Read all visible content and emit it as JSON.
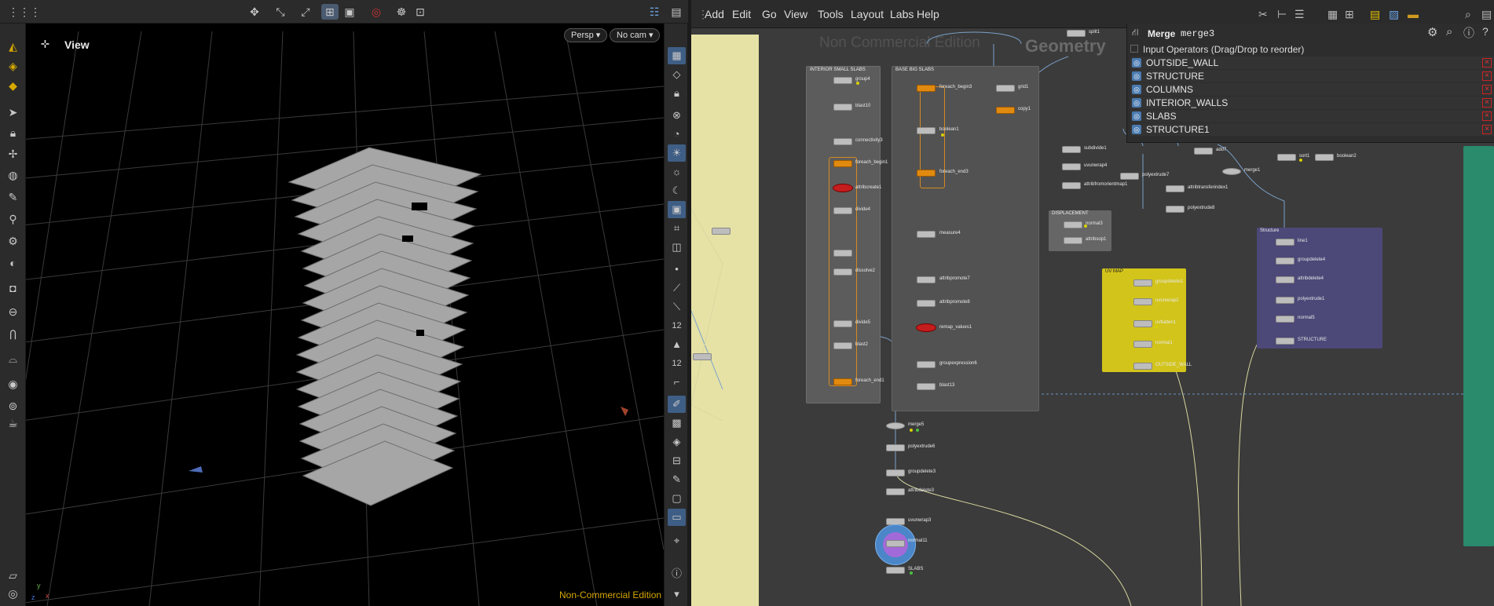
{
  "viewport": {
    "label": "View",
    "camera_mode": "Persp",
    "camera": "No cam",
    "watermark": "Non-Commercial Edition",
    "axis_y": "y",
    "axis_x": "x",
    "axis_z": "z",
    "right_num_1": "12",
    "right_num_2": "12"
  },
  "menubar": {
    "items": [
      "Add",
      "Edit",
      "Go",
      "View",
      "Tools",
      "Layout",
      "Labs",
      "Help"
    ]
  },
  "network": {
    "watermark": "Non Commercial Edition",
    "context_title": "Geometry",
    "boxes": {
      "interior_small_slabs": "INTERIOR SMALL SLABS",
      "base_big_slabs": "BASE BIG SLABS",
      "displacement": "DISPLACEMENT",
      "uv_map": "UV MAP",
      "structure": "Structure"
    },
    "nodes": {
      "group4": "group4",
      "blast10": "blast10",
      "connectivity3": "connectivity3",
      "foreach_begin1": "foreach_begin1",
      "attribcreate1": "attribcreate1",
      "divide4": "divide4",
      "dissolve2": "dissolve2",
      "divide5": "divide5",
      "blast2": "blast2",
      "foreach_end1": "foreach_end1",
      "foreach_begin3": "foreach_begin3",
      "grid1": "grid1",
      "copy1": "copy1",
      "boolean1": "boolean1",
      "foreach_end3": "foreach_end3",
      "measure4": "measure4",
      "attribpromote7": "attribpromote7",
      "attribpromote8": "attribpromote8",
      "remap_values1": "remap_values1",
      "groupexpression6": "groupexpression6",
      "blast13": "blast13",
      "merge5": "merge5",
      "polyextrude6": "polyextrude6",
      "groupdelete3": "groupdelete3",
      "attribdelete3": "attribdelete3",
      "uvunwrap3": "uvunwrap3",
      "normal11": "normal11",
      "slabs_out": "SLABS",
      "subdivide1": "subdivide1",
      "uvunwrap4": "uvunwrap4",
      "attribfromorientmap1": "attribfromorientmap1",
      "polyextrude7": "polyextrude7",
      "attribtransferindex1": "attribtransferindex1",
      "polyextrude8": "polyextrude8",
      "normal3": "normal3",
      "attribsop1": "attribsop1",
      "add7": "add7",
      "merge1": "merge1",
      "sort1": "sort1",
      "boolean2": "boolean2",
      "split1": "split1",
      "grp_uv": "groupdelete1",
      "uvunwrap_uv": "uvunwrap2",
      "uvflatten_uv": "uvflatten1",
      "normal_uv": "normal1",
      "outside_wall_out": "OUTSIDE_WALL",
      "line1": "line1",
      "groupdelete4": "groupdelete4",
      "attribdelete4": "attribdelete4",
      "polyextrude1": "polyextrude1",
      "normal5": "normal5",
      "structure_out": "STRUCTURE",
      "merge3": "merge3"
    }
  },
  "params": {
    "node_type": "Merge",
    "node_name": "merge3",
    "section_label": "Input Operators (Drag/Drop to reorder)",
    "inputs": [
      "OUTSIDE_WALL",
      "STRUCTURE",
      "COLUMNS",
      "INTERIOR_WALLS",
      "SLABS",
      "STRUCTURE1"
    ]
  }
}
